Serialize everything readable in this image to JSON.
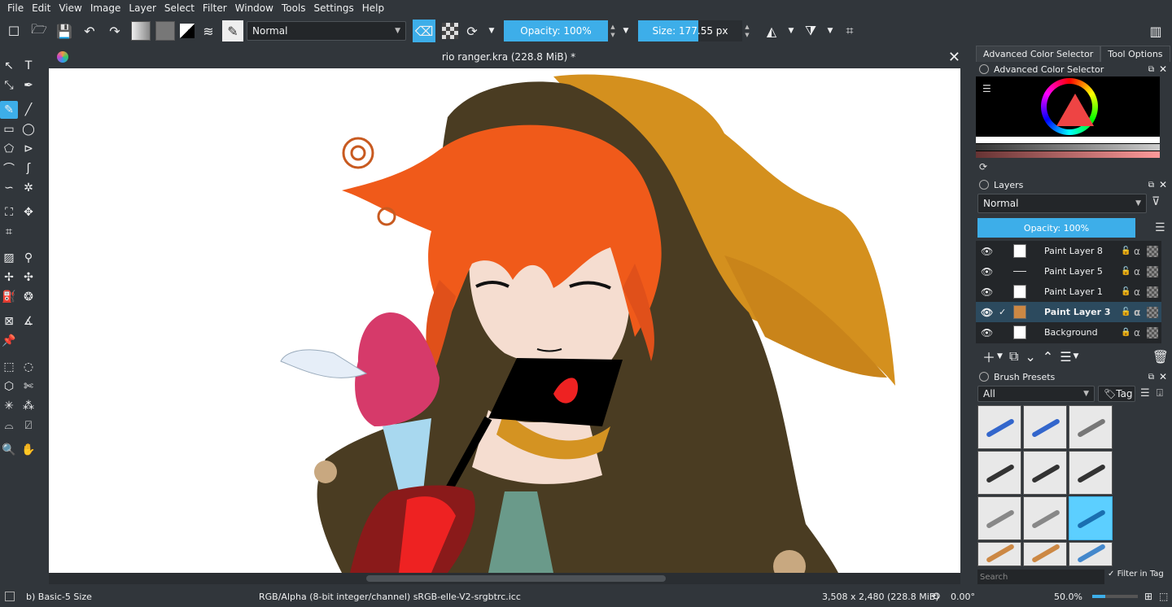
{
  "menu": [
    "File",
    "Edit",
    "View",
    "Image",
    "Layer",
    "Select",
    "Filter",
    "Window",
    "Tools",
    "Settings",
    "Help"
  ],
  "toolbar": {
    "blend_mode": "Normal",
    "opacity_label": "Opacity: 100%",
    "opacity_value": 1.0,
    "size_label": "Size: 177.55 px",
    "size_value": 0.6
  },
  "document": {
    "title": "rio ranger.kra (228.8 MiB) *"
  },
  "dock": {
    "tabs": [
      "Advanced Color Selector",
      "Tool Options"
    ],
    "color_panel_title": "Advanced Color Selector",
    "layers_title": "Layers",
    "layers_blend": "Normal",
    "layers_opacity": "Opacity:  100%",
    "layers": [
      {
        "name": "Paint Layer 8",
        "selected": false,
        "checked": false,
        "locked": false
      },
      {
        "name": "Paint Layer 5",
        "selected": false,
        "checked": false,
        "locked": false
      },
      {
        "name": "Paint Layer 1",
        "selected": false,
        "checked": false,
        "locked": false
      },
      {
        "name": "Paint Layer 3",
        "selected": true,
        "checked": true,
        "locked": false
      },
      {
        "name": "Background",
        "selected": false,
        "checked": false,
        "locked": true
      }
    ],
    "brush_title": "Brush Presets",
    "brush_filter": "All",
    "brush_tag": "Tag",
    "brush_search": "Search",
    "filter_in_tag": "Filter in Tag"
  },
  "status": {
    "brush": "b) Basic-5 Size",
    "color_profile": "RGB/Alpha (8-bit integer/channel)  sRGB-elle-V2-srgbtrc.icc",
    "image_size": "3,508 x 2,480 (228.8 MiB)",
    "rotation": "0.00°",
    "zoom": "50.0%"
  },
  "colors": {
    "accent": "#3daee9",
    "bg": "#31363b",
    "hair_orange": "#f05a1a",
    "hood_brown": "#4a3c22",
    "hood_gold": "#d4901e"
  }
}
